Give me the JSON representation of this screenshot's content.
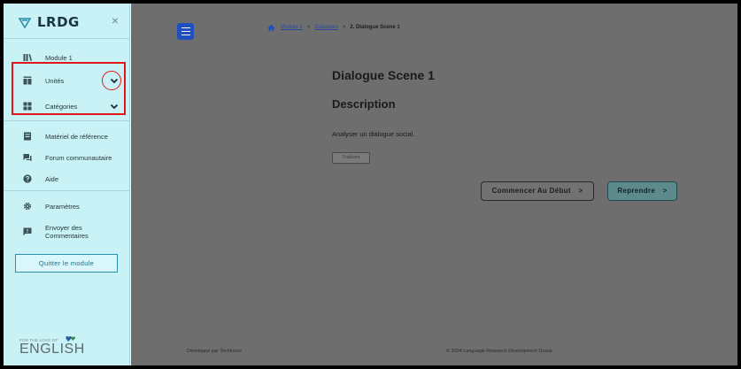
{
  "sidebar": {
    "brand": "LRDG",
    "close_glyph": "×",
    "items": [
      {
        "label": "Module 1",
        "icon": "library-icon"
      },
      {
        "label": "Unités",
        "icon": "units-icon"
      },
      {
        "label": "Catégories",
        "icon": "categories-icon"
      },
      {
        "label": "Matériel de référence",
        "icon": "book-icon"
      },
      {
        "label": "Forum communautaire",
        "icon": "forum-icon"
      },
      {
        "label": "Aide",
        "icon": "help-icon"
      },
      {
        "label": "Paramètres",
        "icon": "gear-icon"
      },
      {
        "label": "Envoyer des Commentaires",
        "icon": "feedback-icon"
      }
    ],
    "quit_button": "Quitter le module",
    "logo": {
      "small": "FOR THE LOVE OF",
      "big": "ENGLISH"
    }
  },
  "breadcrumb": {
    "links": [
      "Module 1",
      "Dialogues"
    ],
    "separator": ">",
    "current": "2. Dialogue Scene 1"
  },
  "main": {
    "title": "Dialogue Scene 1",
    "subtitle": "Description",
    "description": "Analyser un dialogue social.",
    "translate_button": "Traduire",
    "start_button": "Commencer Au Début",
    "resume_button": "Reprendre",
    "button_arrow": ">"
  },
  "footer": {
    "left": "Développé par Techinnov",
    "right": "© 2024 Language Research Development Group"
  },
  "colors": {
    "sidebar_bg": "#c9f2f6",
    "accent": "#1f4fbf",
    "highlight": "#e01818",
    "overlay": "#6e6e6e"
  }
}
